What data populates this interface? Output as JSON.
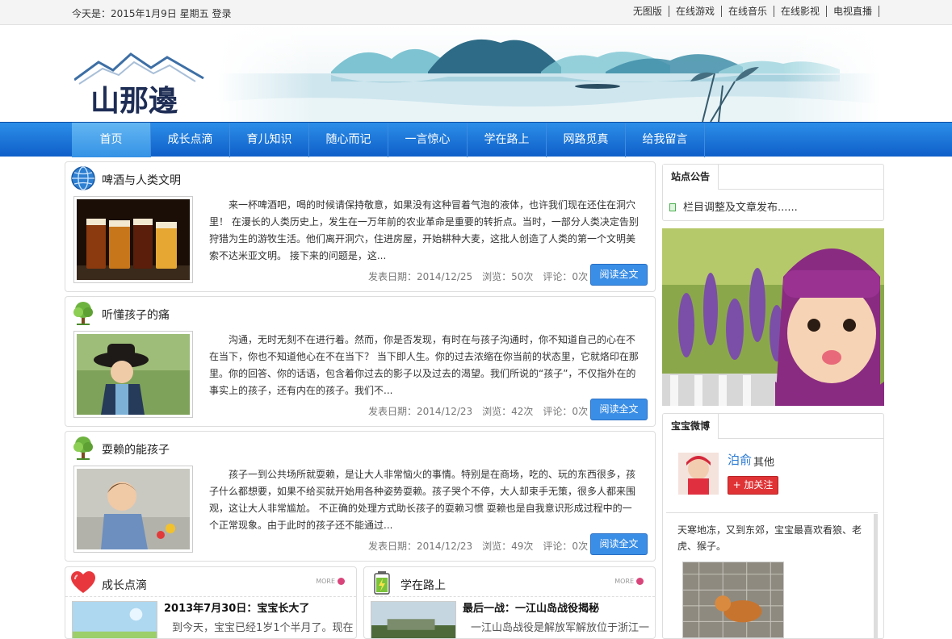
{
  "topbar": {
    "date_text": "今天是：2015年1月9日 星期五",
    "login": "登录",
    "links": [
      "无图版",
      "在线游戏",
      "在线音乐",
      "在线影视",
      "电视直播"
    ]
  },
  "header": {
    "logo_text": "山那邊"
  },
  "nav": {
    "items": [
      "首页",
      "成长点滴",
      "育儿知识",
      "随心而记",
      "一言惊心",
      "学在路上",
      "网路觅真",
      "给我留言"
    ]
  },
  "articles": [
    {
      "title": "啤酒与人类文明",
      "excerpt": "来一杯啤酒吧，喝的时候请保持敬意，如果没有这种冒着气泡的液体，也许我们现在还住在洞穴里！ 在漫长的人类历史上，发生在一万年前的农业革命是重要的转折点。当时，一部分人类决定告别狩猎为生的游牧生活。他们离开洞穴，住进房屋，开始耕种大麦，这批人创造了人类的第一个文明美索不达米亚文明。 接下来的问题是，这...",
      "meta": "发表日期：2014/12/25　浏览：50次　评论：0次",
      "read_more": "阅读全文"
    },
    {
      "title": "听懂孩子的痛",
      "excerpt": "沟通，无时无刻不在进行着。然而，你是否发现，有时在与孩子沟通时，你不知道自己的心在不在当下，你也不知道他心在不在当下？ 当下即人生。你的过去浓缩在你当前的状态里，它就烙印在那里。你的回答、你的话语，包含着你过去的影子以及过去的渴望。我们所说的“孩子”，不仅指外在的事实上的孩子，还有内在的孩子。我们不...",
      "meta": "发表日期：2014/12/23　浏览：42次　评论：0次",
      "read_more": "阅读全文"
    },
    {
      "title": "耍赖的能孩子",
      "excerpt": "孩子一到公共场所就耍赖，是让大人非常恼火的事情。特别是在商场，吃的、玩的东西很多，孩子什么都想要，如果不给买就开始用各种姿势耍赖。孩子哭个不停，大人却束手无策，很多人都来围观，这让大人非常尴尬。 不正确的处理方式助长孩子的耍赖习惯 耍赖也是自我意识形成过程中的一个正常现象。由于此时的孩子还不能通过...",
      "meta": "发表日期：2014/12/23　浏览：49次　评论：0次",
      "read_more": "阅读全文"
    }
  ],
  "boxes": [
    {
      "title": "成长点滴",
      "more": "MORE",
      "entry_title": "2013年7月30日：宝宝长大了",
      "entry_text": "到今天，宝宝已经1岁1个半月了。现在"
    },
    {
      "title": "学在路上",
      "more": "MORE",
      "entry_title": "最后一战：一江山岛战役揭秘",
      "entry_text": "一江山岛战役是解放军解放位于浙江一"
    }
  ],
  "sidebar": {
    "notice": {
      "title": "站点公告",
      "item": "栏目调整及文章发布......"
    },
    "weibo": {
      "title": "宝宝微博",
      "user_name": "泊俞",
      "user_gender": "其他",
      "follow": "+ 加关注",
      "post": "天寒地冻，又到东郊，宝宝最喜欢看狼、老虎、猴子。"
    }
  },
  "colors": {
    "nav_blue": "#1570d6",
    "button_blue": "#3a8ee6",
    "follow_red": "#e03336"
  }
}
